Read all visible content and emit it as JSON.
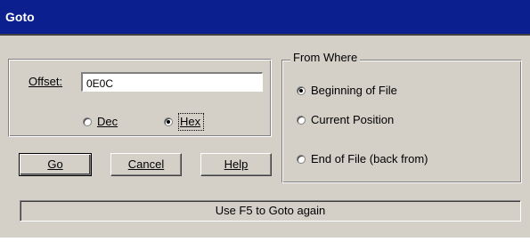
{
  "window": {
    "title": "Goto"
  },
  "offset": {
    "label": "Offset:",
    "value": "0E0C"
  },
  "base": {
    "dec": {
      "label": "Dec",
      "checked": false
    },
    "hex": {
      "label": "Hex",
      "checked": true
    }
  },
  "from_where": {
    "title": "From Where",
    "options": [
      {
        "label": "Beginning of File",
        "checked": true
      },
      {
        "label": "Current Position",
        "checked": false
      },
      {
        "label": "End of File (back from)",
        "checked": false
      }
    ]
  },
  "buttons": {
    "go": "Go",
    "cancel": "Cancel",
    "help": "Help"
  },
  "status": {
    "text": "Use F5 to Goto again"
  }
}
